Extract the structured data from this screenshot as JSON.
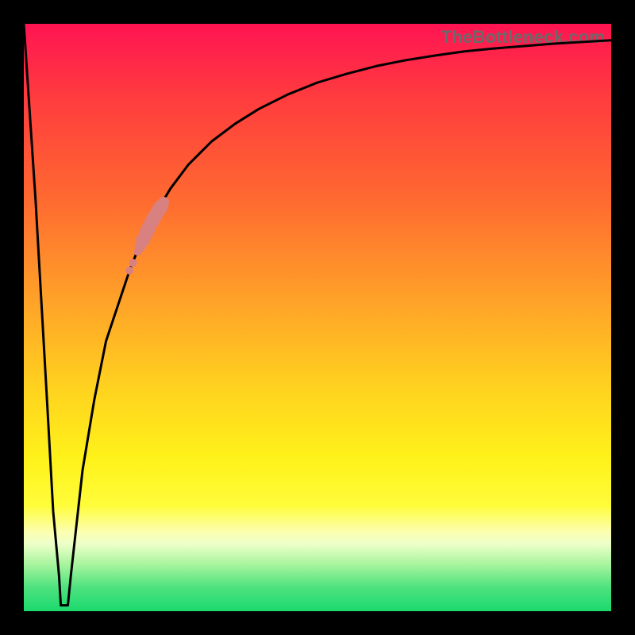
{
  "watermark": "TheBottleneck.com",
  "colors": {
    "frame": "#000000",
    "curve_stroke": "#000000",
    "marker_fill": "#d98080",
    "gradient_top": "#ff1452",
    "gradient_bottom": "#1bd96e"
  },
  "chart_data": {
    "type": "line",
    "title": "",
    "xlabel": "",
    "ylabel": "",
    "xlim": [
      0,
      100
    ],
    "ylim": [
      0,
      100
    ],
    "x": [
      0,
      2,
      4,
      5,
      6,
      6.5,
      7,
      7.5,
      8,
      9,
      10,
      12,
      14,
      16,
      18,
      20,
      22,
      25,
      28,
      32,
      36,
      40,
      45,
      50,
      55,
      60,
      65,
      70,
      75,
      80,
      85,
      90,
      95,
      100
    ],
    "y": [
      100,
      70,
      35,
      17,
      6,
      2,
      1,
      2,
      6,
      15,
      24,
      36,
      46,
      52,
      58,
      63,
      67,
      72,
      76,
      80,
      83,
      85.5,
      88,
      90,
      91.5,
      92.8,
      93.8,
      94.6,
      95.3,
      95.8,
      96.2,
      96.6,
      96.9,
      97.2
    ],
    "dip_floor": {
      "x_range": [
        6.3,
        7.5
      ],
      "y": 1
    },
    "markers": {
      "color": "#d98080",
      "points": [
        {
          "x": 18.0,
          "y": 58.0,
          "r": 5
        },
        {
          "x": 18.6,
          "y": 59.3,
          "r": 5
        },
        {
          "x": 19.4,
          "y": 61.2,
          "r": 5
        },
        {
          "x": 19.8,
          "y": 62.1,
          "r": 7
        },
        {
          "x": 20.3,
          "y": 63.2,
          "r": 9
        },
        {
          "x": 20.8,
          "y": 64.3,
          "r": 9
        },
        {
          "x": 21.3,
          "y": 65.3,
          "r": 9
        },
        {
          "x": 21.8,
          "y": 66.3,
          "r": 9
        },
        {
          "x": 22.3,
          "y": 67.2,
          "r": 9
        },
        {
          "x": 22.8,
          "y": 68.0,
          "r": 9
        },
        {
          "x": 23.3,
          "y": 68.8,
          "r": 9
        },
        {
          "x": 23.8,
          "y": 69.6,
          "r": 7
        }
      ]
    }
  }
}
